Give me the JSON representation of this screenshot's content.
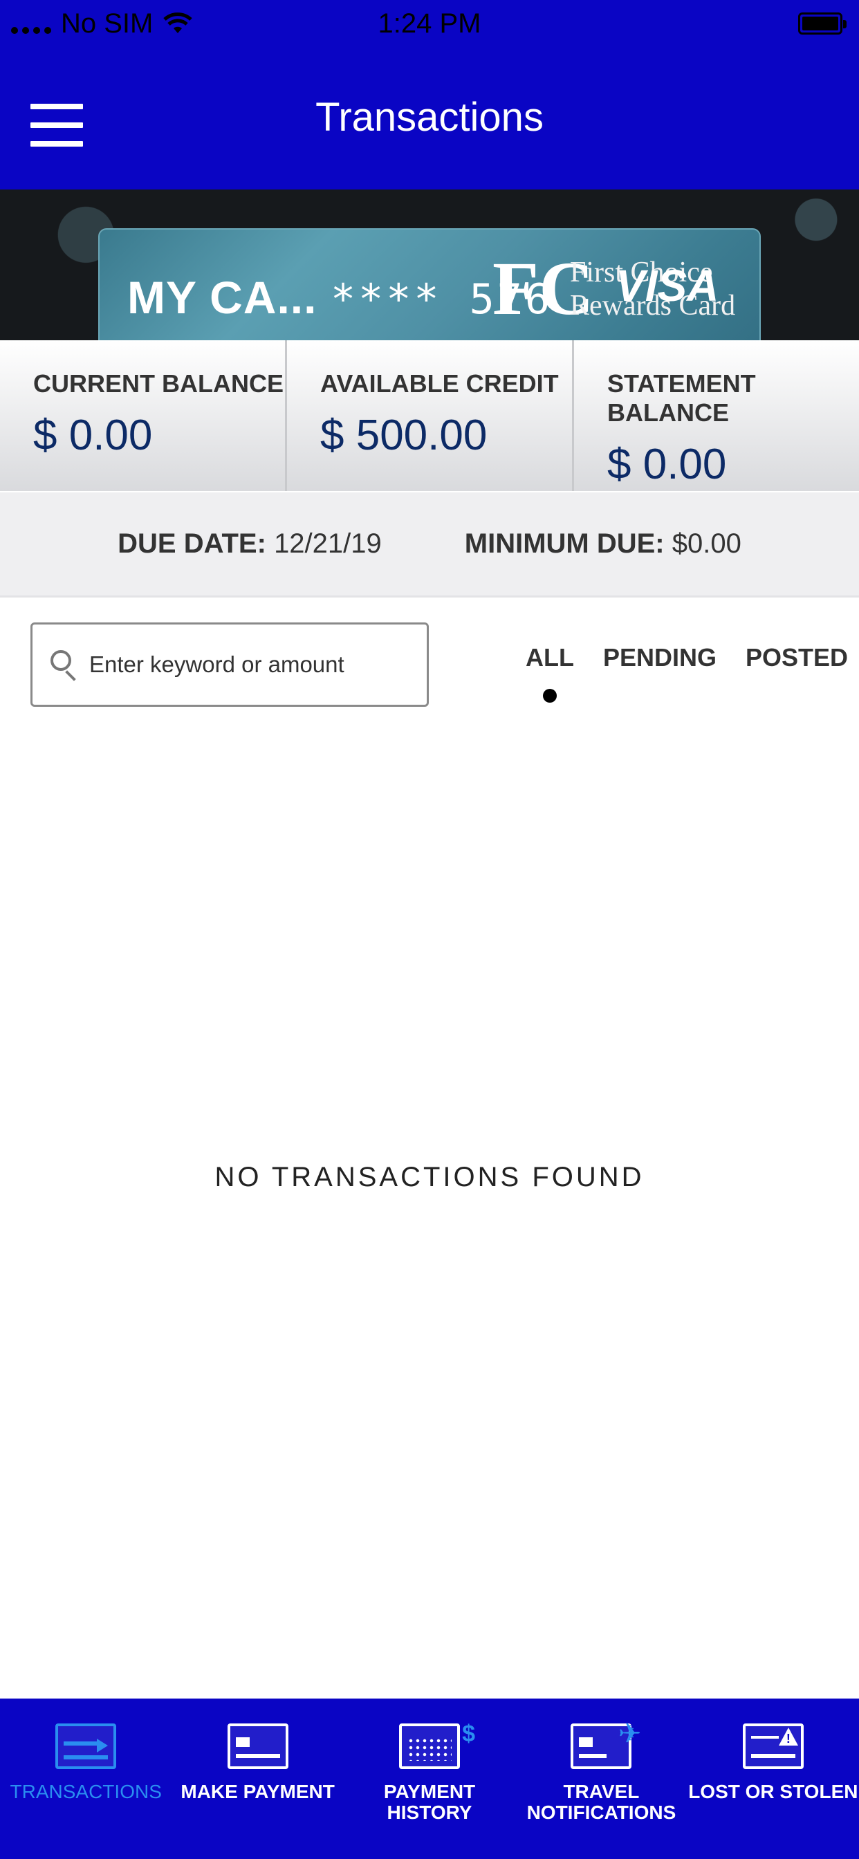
{
  "status_bar": {
    "carrier": "No SIM",
    "time": "1:24 PM"
  },
  "header": {
    "title": "Transactions"
  },
  "card": {
    "name": "MY CA...",
    "number_masked": "**** 576",
    "logo_letters": "FC",
    "brand_line1": "First Choice",
    "brand_line2": "Rewards Card",
    "network": "VISA"
  },
  "balances": [
    {
      "label": "CURRENT BALANCE",
      "value": "$ 0.00"
    },
    {
      "label": "AVAILABLE CREDIT",
      "value": "$ 500.00"
    },
    {
      "label": "STATEMENT BALANCE",
      "value": "$ 0.00"
    }
  ],
  "due": {
    "due_date_label": "DUE DATE:",
    "due_date_value": "12/21/19",
    "minimum_due_label": "MINIMUM DUE:",
    "minimum_due_value": "$0.00"
  },
  "search": {
    "placeholder": "Enter keyword or amount"
  },
  "filters": {
    "selected": "ALL",
    "tabs": [
      "ALL",
      "PENDING",
      "POSTED"
    ]
  },
  "empty_message": "NO TRANSACTIONS FOUND",
  "bottom_tabs": [
    {
      "label": "TRANSACTIONS",
      "icon": "card-transfer-icon",
      "active": true
    },
    {
      "label": "MAKE PAYMENT",
      "icon": "card-payment-icon",
      "active": false
    },
    {
      "label": "PAYMENT\nHISTORY",
      "icon": "calendar-dollar-icon",
      "active": false
    },
    {
      "label": "TRAVEL\nNOTIFICATIONS",
      "icon": "card-plane-icon",
      "active": false
    },
    {
      "label": "LOST OR STOLEN",
      "icon": "card-warning-icon",
      "active": false
    }
  ],
  "colors": {
    "brand_blue": "#0a05c4",
    "active_tab": "#2a8ef0",
    "balance_value": "#0c2a66"
  }
}
